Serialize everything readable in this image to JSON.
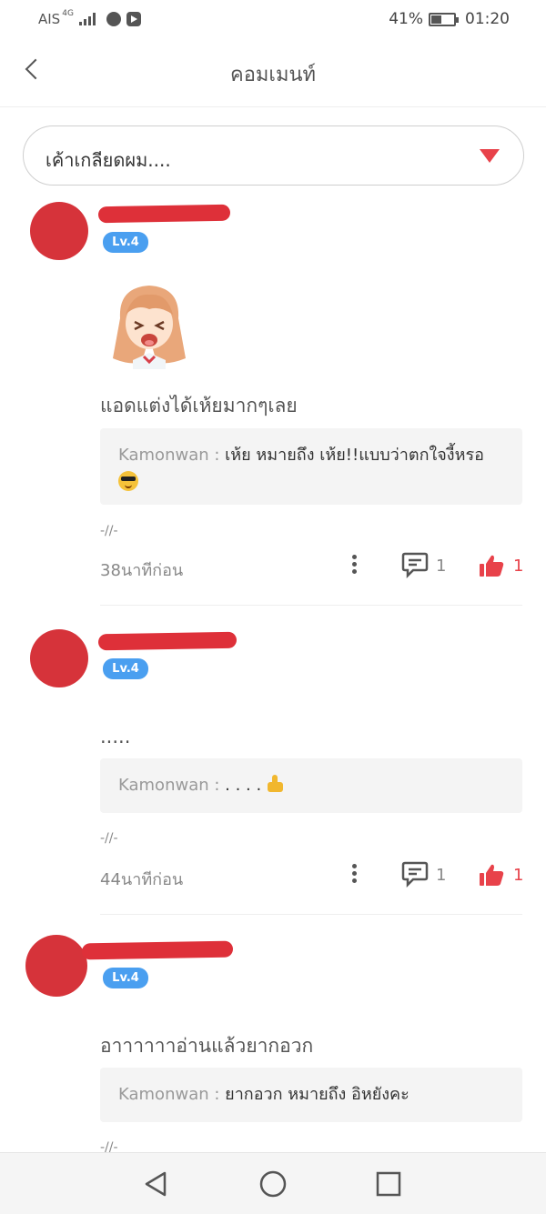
{
  "status_bar": {
    "carrier": "AIS",
    "network": "4G",
    "battery": "41%",
    "time": "01:20"
  },
  "header": {
    "title": "คอมเมนท์"
  },
  "filter": {
    "selected": "เค้าเกลียดผม...."
  },
  "comments": [
    {
      "level": "Lv.4",
      "text": "แอดแต่งได้เห้ยมากๆเลย",
      "has_sticker": true,
      "reply": {
        "author": "Kamonwan : ",
        "text": "เห้ย หมายถึง เห้ย!!แบบว่าตกใจงี้หรอ",
        "emoji": "sunglasses-emoji"
      },
      "marker": "-//-",
      "time": "38นาทีก่อน",
      "reply_count": "1",
      "like_count": "1"
    },
    {
      "level": "Lv.4",
      "text": ".....",
      "has_sticker": false,
      "reply": {
        "author": "Kamonwan : ",
        "text": ". . . . ",
        "emoji": "thumbs-up-emoji"
      },
      "marker": "-//-",
      "time": "44นาทีก่อน",
      "reply_count": "1",
      "like_count": "1"
    },
    {
      "level": "Lv.4",
      "text": "อาาาาาาอ่านแล้วยากอวก",
      "has_sticker": false,
      "reply": {
        "author": "Kamonwan : ",
        "text": "ยากอวก หมายถึง อิหยังคะ"
      },
      "marker": "-//-"
    }
  ],
  "colors": {
    "accent_red": "#e8424a",
    "badge_blue": "#4a9ff0"
  }
}
